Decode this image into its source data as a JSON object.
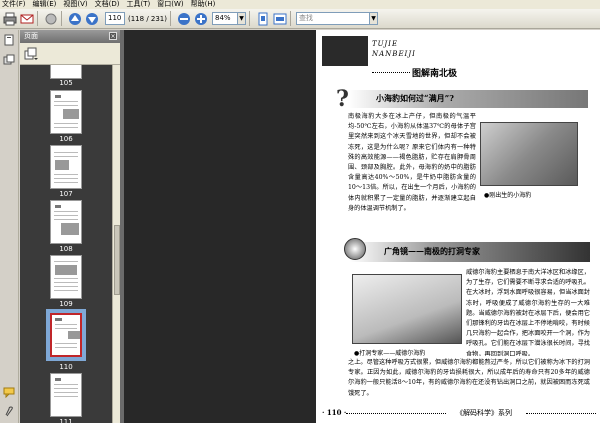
{
  "menu": [
    "文件(F)",
    "编辑(E)",
    "视图(V)",
    "文档(D)",
    "工具(T)",
    "窗口(W)",
    "帮助(H)"
  ],
  "toolbar": {
    "page_current": "110",
    "page_total": "(118 / 231)",
    "zoom": "84%",
    "search_placeholder": "查找"
  },
  "panel": {
    "title": "页面",
    "thumbnails": [
      {
        "label": "105"
      },
      {
        "label": "106"
      },
      {
        "label": "107"
      },
      {
        "label": "108"
      },
      {
        "label": "109"
      },
      {
        "label": "110",
        "selected": true
      },
      {
        "label": "111"
      }
    ]
  },
  "page": {
    "header_en_1": "TUJIE",
    "header_en_2": "NANBEIJI",
    "header_title": "图解南北极",
    "section1_title": "小海豹如何过“满月”?",
    "section1_p1": "南极海豹大多在冰上产仔，但南极的气温平均-50℃左右，小海豹从体温37℃的母体子宫里突然来到这个冰天雪地的世界，但却不会被冻死，这是为什么呢？原来它们体内有一种特殊的高效能源——褐色脂肪，贮存在肩胛骨周围、颈部及胸腔。此外，母海豹的奶中的脂肪含量高达40%～50%，是牛奶中脂肪含量的10～13倍。所以，在出生一个月后，小海豹的体内就积累了一定量的脂肪，并逐渐建立起自身的体温调节机制了。",
    "photo1_caption": "●刚出生的小海豹",
    "section2_title": "广角镜——南极的打洞专家",
    "section2_p1": "威德尔海豹主要栖息于南大洋冰区和冰缘区，为了生存，它们需要不断寻求合适的呼吸孔。在大冰时，浮到水面呼吸很容易，但当冰面封冻时，呼吸便成了威德尔海豹生存的一大难题。当威德尔海豹被封在冰层下后，便会用它们那锋利的牙齿在冰层上不停地啃咬，有时候几只海豹一起合作，把冰面咬开一个洞，作为呼吸孔。它们能在冰层下潜泳很长时间，寻找食物，再回到洞口呼吸。",
    "photo2_caption": "●打洞专家——威德尔海豹",
    "section2_p2": "之上。尽管这种呼吸方式很累，但威德尔海豹都能熬过严冬，所以它们被称为冰下的打洞专家。正因为如此，威德尔海豹的牙齿损耗很大，所以成年后的寿命只有20多年的威德尔海豹一般只能活8～10年，有的威德尔海豹在还没有钻出洞口之前，就因被困而冻死或饿死了。",
    "page_number": "· 110 ·",
    "series": "《解码科学》系列"
  }
}
